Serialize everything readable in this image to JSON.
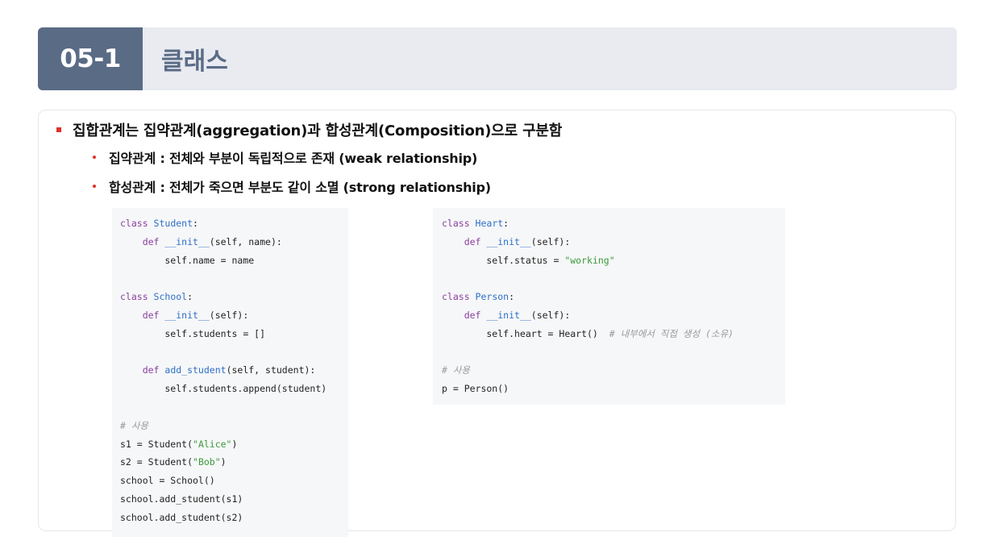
{
  "header": {
    "section_number": "05-1",
    "section_title": "클래스"
  },
  "bullets": {
    "main": "집합관계는 집약관계(aggregation)과 합성관계(Composition)으로 구분함",
    "sub1": "집약관계 : 전체와 부분이 독립적으로 존재 (weak relationship)",
    "sub2": "합성관계 : 전체가 죽으면 부분도 같이 소멸 (strong relationship)"
  },
  "code_left": [
    [
      {
        "t": "class ",
        "c": "kw"
      },
      {
        "t": "Student",
        "c": "nm"
      },
      {
        "t": ":",
        "c": ""
      }
    ],
    [
      {
        "t": "    def ",
        "c": "kw"
      },
      {
        "t": "__init__",
        "c": "nm"
      },
      {
        "t": "(self, name):",
        "c": ""
      }
    ],
    [
      {
        "t": "        self.name = name",
        "c": ""
      }
    ],
    [],
    [
      {
        "t": "class ",
        "c": "kw"
      },
      {
        "t": "School",
        "c": "nm"
      },
      {
        "t": ":",
        "c": ""
      }
    ],
    [
      {
        "t": "    def ",
        "c": "kw"
      },
      {
        "t": "__init__",
        "c": "nm"
      },
      {
        "t": "(self):",
        "c": ""
      }
    ],
    [
      {
        "t": "        self.students = []",
        "c": ""
      }
    ],
    [],
    [
      {
        "t": "    def ",
        "c": "kw"
      },
      {
        "t": "add_student",
        "c": "nm"
      },
      {
        "t": "(self, student):",
        "c": ""
      }
    ],
    [
      {
        "t": "        self.students.append(student)",
        "c": ""
      }
    ],
    [],
    [
      {
        "t": "# 사용",
        "c": "cm"
      }
    ],
    [
      {
        "t": "s1 = Student(",
        "c": ""
      },
      {
        "t": "\"Alice\"",
        "c": "st"
      },
      {
        "t": ")",
        "c": ""
      }
    ],
    [
      {
        "t": "s2 = Student(",
        "c": ""
      },
      {
        "t": "\"Bob\"",
        "c": "st"
      },
      {
        "t": ")",
        "c": ""
      }
    ],
    [
      {
        "t": "school = School()",
        "c": ""
      }
    ],
    [
      {
        "t": "school.add_student(s1)",
        "c": ""
      }
    ],
    [
      {
        "t": "school.add_student(s2)",
        "c": ""
      }
    ]
  ],
  "code_right": [
    [
      {
        "t": "class ",
        "c": "kw"
      },
      {
        "t": "Heart",
        "c": "nm"
      },
      {
        "t": ":",
        "c": ""
      }
    ],
    [
      {
        "t": "    def ",
        "c": "kw"
      },
      {
        "t": "__init__",
        "c": "nm"
      },
      {
        "t": "(self):",
        "c": ""
      }
    ],
    [
      {
        "t": "        self.status = ",
        "c": ""
      },
      {
        "t": "\"working\"",
        "c": "st"
      }
    ],
    [],
    [
      {
        "t": "class ",
        "c": "kw"
      },
      {
        "t": "Person",
        "c": "nm"
      },
      {
        "t": ":",
        "c": ""
      }
    ],
    [
      {
        "t": "    def ",
        "c": "kw"
      },
      {
        "t": "__init__",
        "c": "nm"
      },
      {
        "t": "(self):",
        "c": ""
      }
    ],
    [
      {
        "t": "        self.heart = Heart()  ",
        "c": ""
      },
      {
        "t": "# 내부에서 직접 생성 (소유)",
        "c": "cm"
      }
    ],
    [],
    [
      {
        "t": "# 사용",
        "c": "cm"
      }
    ],
    [
      {
        "t": "p = Person()",
        "c": ""
      }
    ]
  ]
}
